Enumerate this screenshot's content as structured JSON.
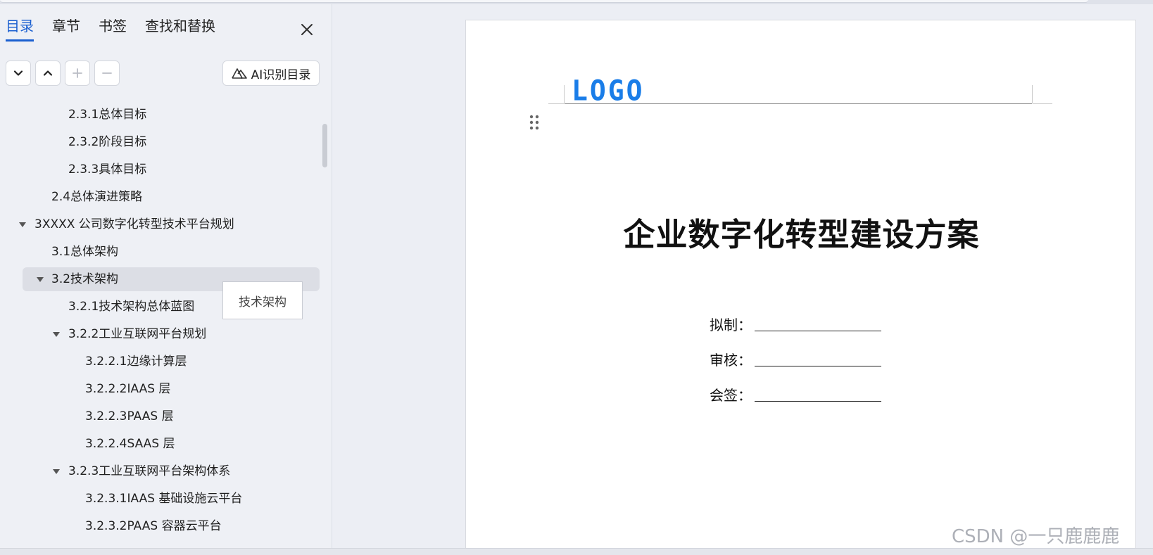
{
  "panel": {
    "tabs": [
      {
        "label": "目录"
      },
      {
        "label": "章节"
      },
      {
        "label": "书签"
      },
      {
        "label": "查找和替换"
      }
    ],
    "ai_button_label": "AI识别目录",
    "tooltip": "技术架构"
  },
  "toc": [
    {
      "label": "2.3.1总体目标"
    },
    {
      "label": "2.3.2阶段目标"
    },
    {
      "label": "2.3.3具体目标"
    },
    {
      "label": "2.4总体演进策略"
    },
    {
      "label": "3XXXX 公司数字化转型技术平台规划"
    },
    {
      "label": "3.1总体架构"
    },
    {
      "label": "3.2技术架构"
    },
    {
      "label": "3.2.1技术架构总体蓝图"
    },
    {
      "label": "3.2.2工业互联网平台规划"
    },
    {
      "label": "3.2.2.1边缘计算层"
    },
    {
      "label": "3.2.2.2IAAS 层"
    },
    {
      "label": "3.2.2.3PAAS 层"
    },
    {
      "label": "3.2.2.4SAAS 层"
    },
    {
      "label": "3.2.3工业互联网平台架构体系"
    },
    {
      "label": "3.2.3.1IAAS 基础设施云平台"
    },
    {
      "label": "3.2.3.2PAAS 容器云平台"
    }
  ],
  "document": {
    "logo_text": "LOGO",
    "title": "企业数字化转型建设方案",
    "sign_fields": [
      {
        "label": "拟制："
      },
      {
        "label": "审核："
      },
      {
        "label": "会签："
      }
    ]
  },
  "watermark": "CSDN @一只鹿鹿鹿",
  "colors": {
    "accent": "#1a5fd0",
    "logo": "#1a7de8"
  }
}
